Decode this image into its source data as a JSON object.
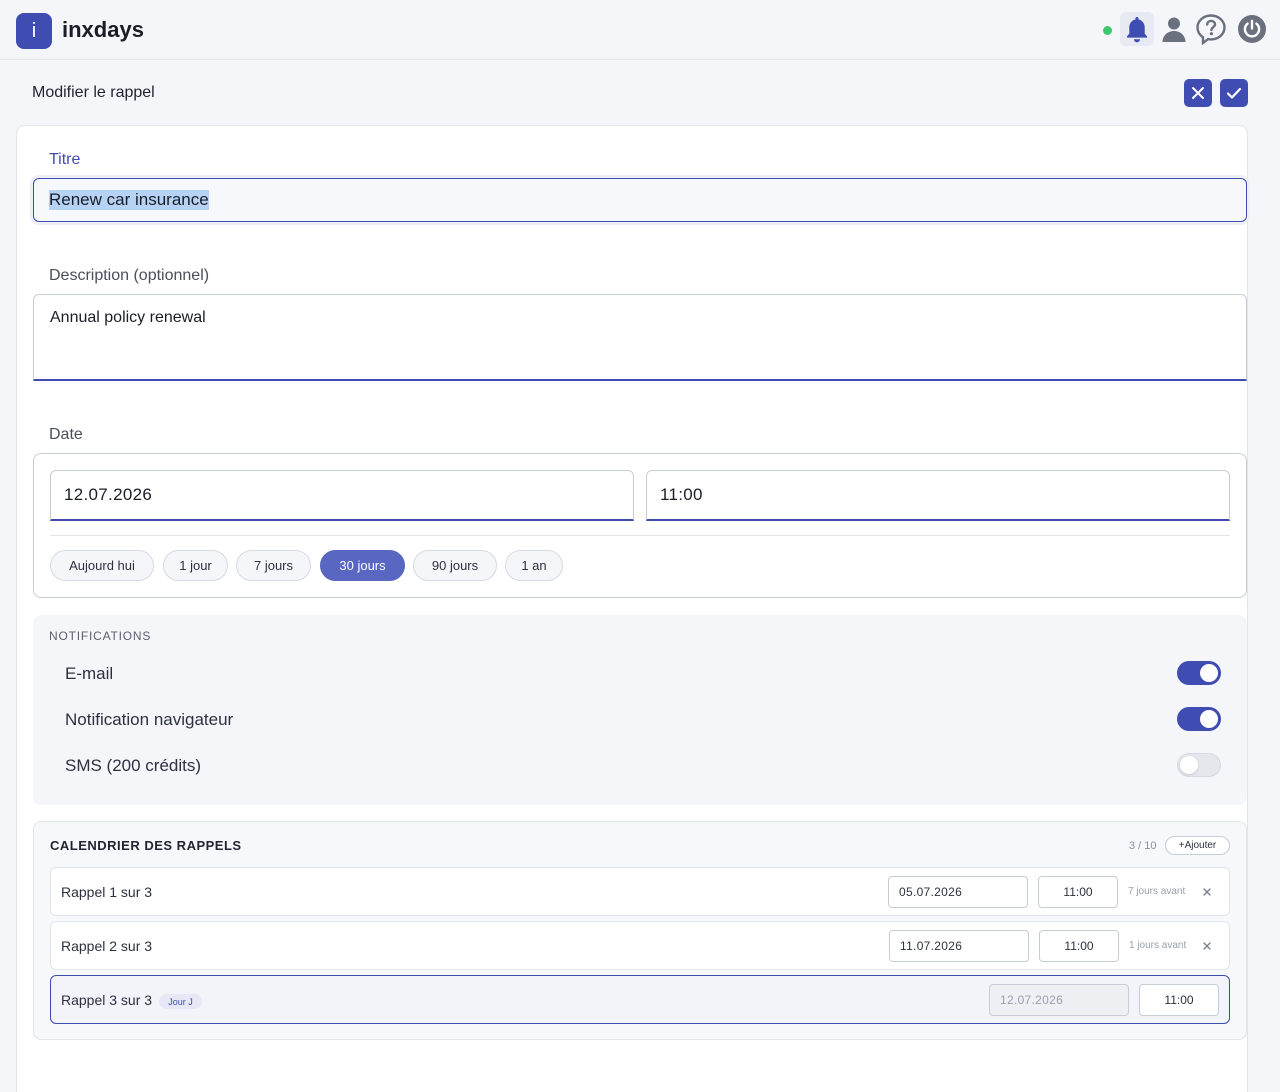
{
  "app": {
    "logo_letter": "i",
    "name": "inxdays"
  },
  "topbar": {
    "icons": [
      "bell-icon",
      "user-icon",
      "help-icon",
      "power-icon"
    ],
    "status_color": "#3cc86c"
  },
  "header": {
    "title": "Modifier le rappel"
  },
  "form": {
    "title_label": "Titre",
    "title_value": "Renew car insurance",
    "description_label": "Description (optionnel)",
    "description_value": "Annual policy renewal",
    "date_label": "Date",
    "date_value": "12.07.2026",
    "time_value": "11:00",
    "quick_dates": [
      "Aujourd hui",
      "1 jour",
      "7 jours",
      "30 jours",
      "90 jours",
      "1 an"
    ],
    "quick_selected": "30 jours"
  },
  "notifications": {
    "heading": "NOTIFICATIONS",
    "items": [
      {
        "label": "E-mail",
        "enabled": true
      },
      {
        "label": "Notification navigateur",
        "enabled": true
      },
      {
        "label": "SMS (200 crédits)",
        "enabled": false
      }
    ]
  },
  "calendar": {
    "heading": "CALENDRIER DES RAPPELS",
    "count": "3 / 10",
    "add_label": "+Ajouter",
    "rows": [
      {
        "label": "Rappel 1 sur 3",
        "date": "05.07.2026",
        "time": "11:00",
        "before": "7 jours avant"
      },
      {
        "label": "Rappel 2 sur 3",
        "date": "11.07.2026",
        "time": "11:00",
        "before": "1 jours avant"
      },
      {
        "label": "Rappel 3 sur 3",
        "badge": "Jour J",
        "date": "12.07.2026",
        "time": "11:00"
      }
    ]
  },
  "colors": {
    "accent": "#3f4cb1",
    "chip_selected": "#5966c2"
  }
}
